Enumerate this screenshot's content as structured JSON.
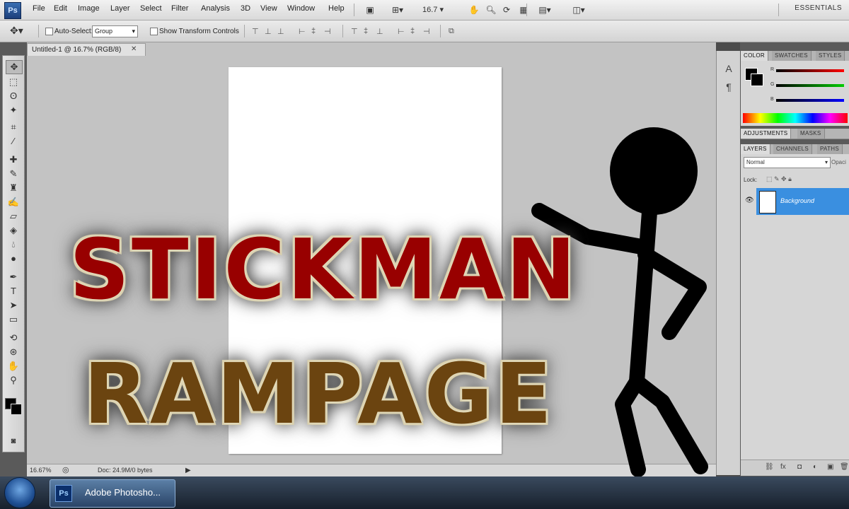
{
  "app": {
    "logo_text": "Ps",
    "workspace": "ESSENTIALS"
  },
  "menu": [
    "File",
    "Edit",
    "Image",
    "Layer",
    "Select",
    "Filter",
    "Analysis",
    "3D",
    "View",
    "Window",
    "Help"
  ],
  "toolbar": {
    "zoom": "16.7"
  },
  "options": {
    "auto_select_label": "Auto-Select:",
    "auto_select_value": "Group",
    "show_transform_label": "Show Transform Controls"
  },
  "document": {
    "tab_title": "Untitled-1 @ 16.7% (RGB/8)",
    "status_zoom": "16.67%",
    "status_info": "Doc: 24.9M/0 bytes"
  },
  "panels": {
    "color_tabs": [
      "COLOR",
      "SWATCHES",
      "STYLES"
    ],
    "adj_tabs": [
      "ADJUSTMENTS",
      "MASKS"
    ],
    "layer_tabs": [
      "LAYERS",
      "CHANNELS",
      "PATHS"
    ],
    "blend_mode": "Normal",
    "opacity_label": "Opaci",
    "lock_label": "Lock:",
    "layer_name": "Background",
    "rgb_labels": [
      "R",
      "G",
      "B"
    ]
  },
  "taskbar": {
    "app_label": "Adobe Photosho..."
  },
  "title": {
    "line1": "STICKMAN",
    "line2": "RAMPAGE"
  },
  "colors": {
    "title_line1": "#980000",
    "title_line2": "#6b4410",
    "layer_selected": "#3a8fe0"
  }
}
